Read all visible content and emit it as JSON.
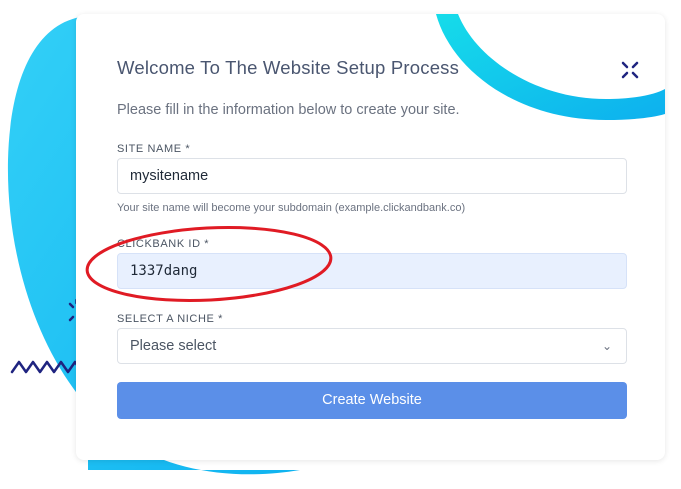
{
  "colors": {
    "accent_blob": "#22c4f2",
    "ring": "#16c9ea",
    "sparkle": "#1f2480",
    "annotation": "#e01b24",
    "button": "#5b8fe8",
    "filled_input": "#e8f0fe"
  },
  "form": {
    "title": "Welcome To The Website Setup Process",
    "subtitle": "Please fill in the information below to create your site.",
    "site_name": {
      "label": "SITE NAME *",
      "value": "mysitename",
      "hint": "Your site name will become your subdomain (example.clickandbank.co)"
    },
    "clickbank_id": {
      "label": "CLICKBANK ID *",
      "value": "1337dang"
    },
    "niche": {
      "label": "SELECT A NICHE *",
      "selected": "Please select",
      "chevron": "⌄"
    },
    "submit_label": "Create Website"
  }
}
